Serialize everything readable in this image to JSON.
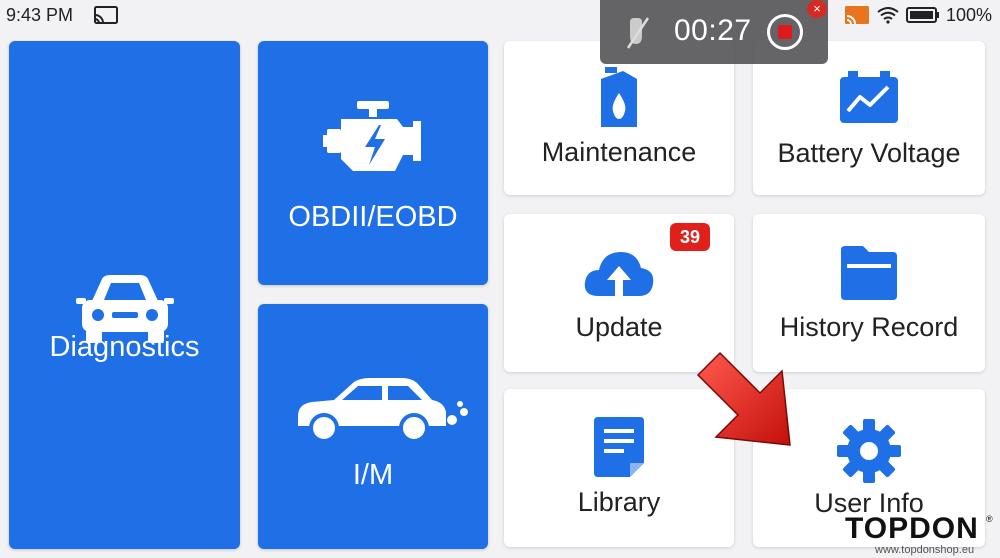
{
  "status_bar": {
    "time": "9:43 PM",
    "battery_percent": "100%",
    "icons": [
      "cast-icon",
      "cast-icon",
      "wifi-icon",
      "battery-icon"
    ]
  },
  "recording": {
    "timer": "00:27",
    "close_symbol": "×"
  },
  "tiles": {
    "diagnostics": {
      "label": "Diagnostics",
      "icon": "car-front-icon"
    },
    "obd": {
      "label": "OBDII/EOBD",
      "icon": "engine-icon"
    },
    "im": {
      "label": "I/M",
      "icon": "car-side-emission-icon"
    },
    "maintenance": {
      "label": "Maintenance",
      "icon": "oil-can-icon"
    },
    "battery_voltage": {
      "label": "Battery Voltage",
      "icon": "battery-graph-icon"
    },
    "update": {
      "label": "Update",
      "icon": "cloud-upload-icon",
      "badge": "39"
    },
    "history_record": {
      "label": "History Record",
      "icon": "folder-icon"
    },
    "library": {
      "label": "Library",
      "icon": "document-icon"
    },
    "user_info": {
      "label": "User Info",
      "icon": "gear-icon"
    }
  },
  "watermark": {
    "brand": "TOPDON",
    "reg": "®",
    "url": "www.topdonshop.eu"
  },
  "colors": {
    "tile_blue": "#1f6fe6",
    "icon_blue": "#1f6fe6",
    "badge_red": "#e0211b",
    "arrow_red": "#e01a14"
  }
}
